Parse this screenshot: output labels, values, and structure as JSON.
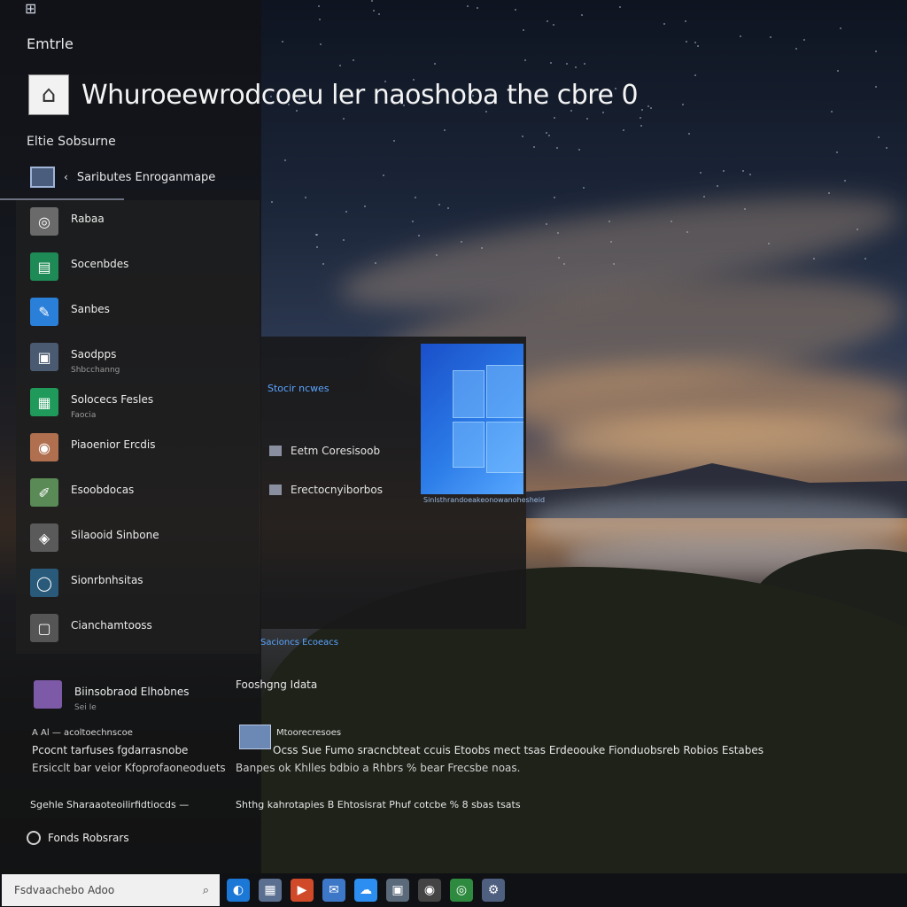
{
  "start_menu": {
    "heading": "Emtrle",
    "title": "Whuroeewrodcoeu ler naoshoba the cbre 0",
    "section_label": "Eltie Sobsurne",
    "pinned_header": "Saributes Enroganmape",
    "apps": [
      {
        "name": "Rabaa",
        "sub": "",
        "color": "#6a6a6a",
        "glyph": "◎"
      },
      {
        "name": "Socenbdes",
        "sub": "",
        "color": "#1e8a55",
        "glyph": "▤"
      },
      {
        "name": "Sanbes",
        "sub": "",
        "color": "#2a7fd8",
        "glyph": "✎"
      },
      {
        "name": "Saodpps",
        "sub": "Shbcchanng",
        "color": "#4a5a70",
        "glyph": "▣"
      },
      {
        "name": "Solocecs Fesles",
        "sub": "Faocia",
        "color": "#1f9a5a",
        "glyph": "▦"
      },
      {
        "name": "Piaoenior Ercdis",
        "sub": "",
        "color": "#b07050",
        "glyph": "◉"
      },
      {
        "name": "Esoobdocas",
        "sub": "",
        "color": "#5a8a55",
        "glyph": "✐"
      },
      {
        "name": "Silaooid Sinbone",
        "sub": "",
        "color": "#5a5a5a",
        "glyph": "◈"
      },
      {
        "name": "Sionrbnhsitas",
        "sub": "",
        "color": "#2a5a7a",
        "glyph": "◯"
      },
      {
        "name": "Cianchamtooss",
        "sub": "",
        "color": "#555555",
        "glyph": "▢"
      }
    ],
    "mid_panel": {
      "blue_link": "Stocir ncwes",
      "entries": [
        "Eetm Coresisoob",
        "Erectocnyiborbos"
      ],
      "tile_caption": "Sinlsthrandoeakeonowanohesheid",
      "below_link": "Sacioncs Ecoeacs"
    },
    "lower": {
      "app_name": "Biinsobraod Elhobnes",
      "app_sub": "Sei Ie",
      "right_heading": "Fooshgng Idata",
      "small_label": "A Al — acoltoechnscoe",
      "info_title": "Mtoorecresoes",
      "lines": [
        "Pcocnt tarfuses fgdarrasnobe",
        "Ersicclt bar veior Kfoprofaoneoduets",
        "Ocss Sue Fumo sracncbteat ccuis Etoobs mect tsas Erdeoouke Fionduobsreb Robios Estabes",
        "Banpes ok Khlles bdbio a Rhbrs % bear Frecsbe noas.",
        "Sgehle Sharaaoteoilirfidtiocds —",
        "Shthg kahrotapies B Ehtosisrat Phuf cotcbe % 8 sbas tsats"
      ],
      "footer": "Fonds Robsrars"
    }
  },
  "taskbar": {
    "search_value": "Fsdvaachebo Adoo",
    "icons": [
      {
        "name": "edge-icon",
        "color": "#1b78d6",
        "glyph": "◐"
      },
      {
        "name": "store-icon",
        "color": "#5b6f91",
        "glyph": "▦"
      },
      {
        "name": "media-icon",
        "color": "#d04a2a",
        "glyph": "▶"
      },
      {
        "name": "mail-icon",
        "color": "#3d78c8",
        "glyph": "✉"
      },
      {
        "name": "onedrive-icon",
        "color": "#2b8ef0",
        "glyph": "☁"
      },
      {
        "name": "photos-icon",
        "color": "#5a6a7a",
        "glyph": "▣"
      },
      {
        "name": "camera-icon",
        "color": "#444444",
        "glyph": "◉"
      },
      {
        "name": "xbox-icon",
        "color": "#2e8a3e",
        "glyph": "◎"
      },
      {
        "name": "settings-icon",
        "color": "#4f5f80",
        "glyph": "⚙"
      }
    ]
  }
}
